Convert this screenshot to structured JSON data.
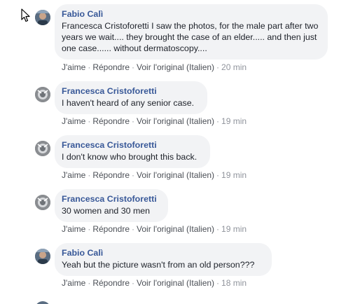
{
  "comments": [
    {
      "author": "Fabio Calì",
      "text": "Francesca Cristoforetti I saw the photos, for the male part after two years we wait.... they brought the case of an elder..... and then just one case...... without dermatoscopy....",
      "like": "J'aime",
      "reply": "Répondre",
      "original": "Voir l'original (Italien)",
      "time": "20 min",
      "avatar": "fabio-avatar"
    },
    {
      "author": "Francesca Cristoforetti",
      "text": "I haven't heard of any senior case.",
      "like": "J'aime",
      "reply": "Répondre",
      "original": "Voir l'original (Italien)",
      "time": "19 min",
      "avatar": "francesca-avatar"
    },
    {
      "author": "Francesca Cristoforetti",
      "text": "I don't know who brought this back.",
      "like": "J'aime",
      "reply": "Répondre",
      "original": "Voir l'original (Italien)",
      "time": "19 min",
      "avatar": "francesca-avatar"
    },
    {
      "author": "Francesca Cristoforetti",
      "text": "30 women and 30 men",
      "like": "J'aime",
      "reply": "Répondre",
      "original": "Voir l'original (Italien)",
      "time": "19 min",
      "avatar": "francesca-avatar"
    },
    {
      "author": "Fabio Calì",
      "text": "Yeah but the picture wasn't from an old person???",
      "like": "J'aime",
      "reply": "Répondre",
      "original": "Voir l'original (Italien)",
      "time": "18 min",
      "avatar": "fabio-avatar"
    }
  ],
  "separator": "·",
  "colors": {
    "author": "#385898",
    "bubble": "#f2f3f5",
    "meta": "#606770"
  }
}
